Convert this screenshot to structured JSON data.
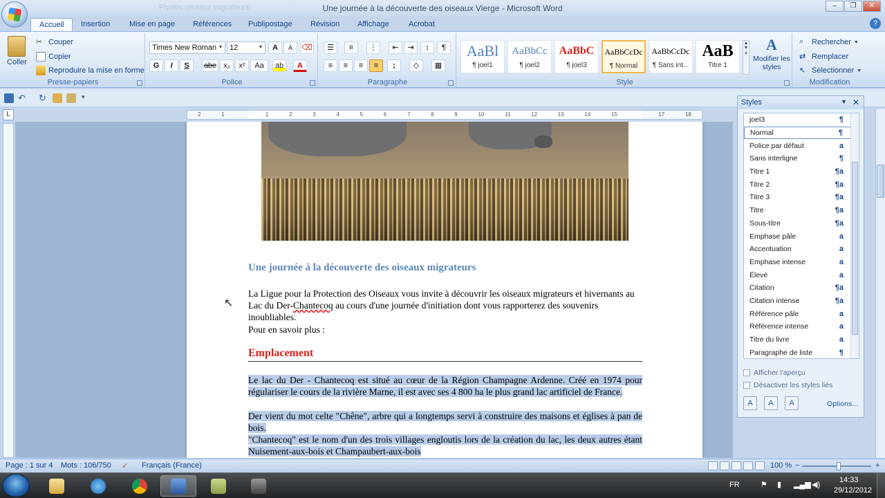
{
  "window": {
    "title": "Une journée à la découverte des oiseaux  Vierge  -  Microsoft Word",
    "faded_title": "Photos oiseaux migrateurs",
    "controls": [
      "–",
      "❐",
      "✕"
    ]
  },
  "tabs": [
    "Accueil",
    "Insertion",
    "Mise en page",
    "Références",
    "Publipostage",
    "Révision",
    "Affichage",
    "Acrobat"
  ],
  "active_tab": "Accueil",
  "help_glyph": "?",
  "ribbon": {
    "clipboard": {
      "label": "Presse-papiers",
      "paste": "Coller",
      "cut": "Couper",
      "copy": "Copier",
      "format_painter": "Reproduire la mise en forme"
    },
    "font": {
      "label": "Police",
      "family": "Times New Roman",
      "size": "12",
      "grow": "A",
      "shrink": "A",
      "bold": "G",
      "italic": "I",
      "underline": "S",
      "strike": "abe",
      "sub": "x₂",
      "sup": "x²",
      "case": "Aa",
      "font_color": "A"
    },
    "paragraph": {
      "label": "Paragraphe",
      "pilcrow": "¶"
    },
    "styles": {
      "label": "Style",
      "cards": [
        {
          "sample": "AaBl",
          "name": "¶ joel1",
          "color": "#4f81bd",
          "size": "22px",
          "weight": "normal"
        },
        {
          "sample": "AaBbCc",
          "name": "¶ joel2",
          "color": "#4f81bd",
          "size": "15px",
          "weight": "normal"
        },
        {
          "sample": "AaBbC",
          "name": "¶ joel3",
          "color": "#d9231b",
          "size": "16px",
          "weight": "bold"
        },
        {
          "sample": "AaBbCcDc",
          "name": "¶ Normal",
          "color": "#000000",
          "size": "12px",
          "weight": "normal"
        },
        {
          "sample": "AaBbCcDc",
          "name": "¶ Sans int...",
          "color": "#000000",
          "size": "12px",
          "weight": "normal"
        },
        {
          "sample": "AaB",
          "name": "Titre 1",
          "color": "#000000",
          "size": "24px",
          "weight": "bold"
        }
      ],
      "selected_index": 3,
      "change_styles": "Modifier les styles"
    },
    "editing": {
      "label": "Modification",
      "find": "Rechercher",
      "replace": "Remplacer",
      "select": "Sélectionner"
    }
  },
  "ruler": {
    "corner": "L",
    "ticks": [
      "2",
      "1",
      "",
      "1",
      "2",
      "3",
      "4",
      "5",
      "6",
      "7",
      "8",
      "9",
      "10",
      "11",
      "12",
      "13",
      "14",
      "15",
      "",
      "17",
      "18"
    ]
  },
  "document": {
    "heading": "Une journée à la découverte des oiseaux migrateurs",
    "para1_before": "La Ligue pour la Protection des Oiseaux vous invite à découvrir les oiseaux migrateurs et hivernants au Lac du Der-",
    "para1_misspelled": "Chantecoq",
    "para1_after": " au cours d'une journée d'initiation dont vous rapporterez des souvenirs inoubliables.",
    "para2": "Pour en savoir plus :",
    "section_heading": "Emplacement",
    "sel_line1": "Le lac du Der - Chantecoq est situé au cœur de la Région Champagne Ardenne. Créé en 1974 pour régulariser le cours de la rivière Marne, il est avec ses 4 800 ha le plus grand lac artificiel de France.",
    "sel_line2": "Der vient du mot celte \"Chêne\", arbre qui a longtemps servi à construire des maisons et églises à pan de bois.",
    "sel_line3": "\"Chantecoq\" est le nom d'un des trois villages engloutis lors de la création du lac, les deux autres étant Nuisement-aux-bois et Champaubert-aux-bois"
  },
  "styles_pane": {
    "title": "Styles",
    "items": [
      {
        "name": "joel3",
        "mark": "¶"
      },
      {
        "name": "Normal",
        "mark": "¶"
      },
      {
        "name": "Police par défaut",
        "mark": "a"
      },
      {
        "name": "Sans interligne",
        "mark": "¶"
      },
      {
        "name": "Titre 1",
        "mark": "¶a"
      },
      {
        "name": "Titre 2",
        "mark": "¶a"
      },
      {
        "name": "Titre 3",
        "mark": "¶a"
      },
      {
        "name": "Titre",
        "mark": "¶a"
      },
      {
        "name": "Sous-titre",
        "mark": "¶a"
      },
      {
        "name": "Emphase pâle",
        "mark": "a"
      },
      {
        "name": "Accentuation",
        "mark": "a"
      },
      {
        "name": "Emphase intense",
        "mark": "a"
      },
      {
        "name": "Élevé",
        "mark": "a"
      },
      {
        "name": "Citation",
        "mark": "¶a"
      },
      {
        "name": "Citation intense",
        "mark": "¶a"
      },
      {
        "name": "Référence pâle",
        "mark": "a"
      },
      {
        "name": "Référence intense",
        "mark": "a"
      },
      {
        "name": "Titre du livre",
        "mark": "a"
      },
      {
        "name": "Paragraphe de liste",
        "mark": "¶"
      }
    ],
    "selected": "Normal",
    "show_preview": "Afficher l'aperçu",
    "disable_linked": "Désactiver les styles liés",
    "options": "Options..."
  },
  "status": {
    "page": "Page : 1 sur 4",
    "words": "Mots : 106/750",
    "language": "Français (France)",
    "zoom": "100 %",
    "zoom_percent": 100
  },
  "taskbar": {
    "lang": "FR",
    "time": "14:33",
    "date": "29/12/2012"
  },
  "colors": {
    "heading": "#5b87b8",
    "section": "#d9231b",
    "selection": "#b9cde9",
    "ribbon_text": "#15428b"
  }
}
